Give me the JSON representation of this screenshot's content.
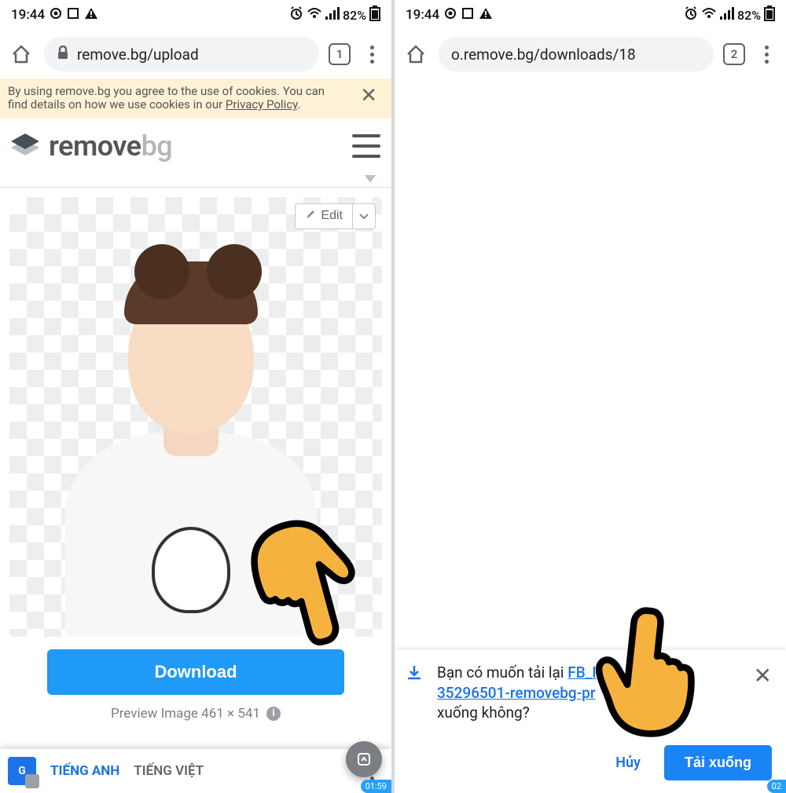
{
  "status": {
    "time": "19:44",
    "battery": "82%"
  },
  "left": {
    "url": "remove.bg/upload",
    "tab_count": "1",
    "cookie_text_a": "By using remove.bg you agree to the use of cookies. You can find details on how we use cookies in our ",
    "cookie_link": "Privacy Policy",
    "cookie_text_b": ".",
    "logo_a": "remove",
    "logo_b": "bg",
    "edit_label": "Edit",
    "download_label": "Download",
    "preview_label": "Preview Image 461 × 541",
    "lang_a": "TIẾNG ANH",
    "lang_b": "TIẾNG VIỆT",
    "time_pill": "01:59"
  },
  "right": {
    "url": "o.remove.bg/downloads/18",
    "tab_count": "2",
    "prompt_a": "Bạn có muốn tải lại ",
    "link_a": "FB_I",
    "link_b": "35296501-removebg-pr",
    "prompt_b": "xuống không?",
    "cancel": "Hủy",
    "confirm": "Tải xuống",
    "time_pill": "02"
  }
}
